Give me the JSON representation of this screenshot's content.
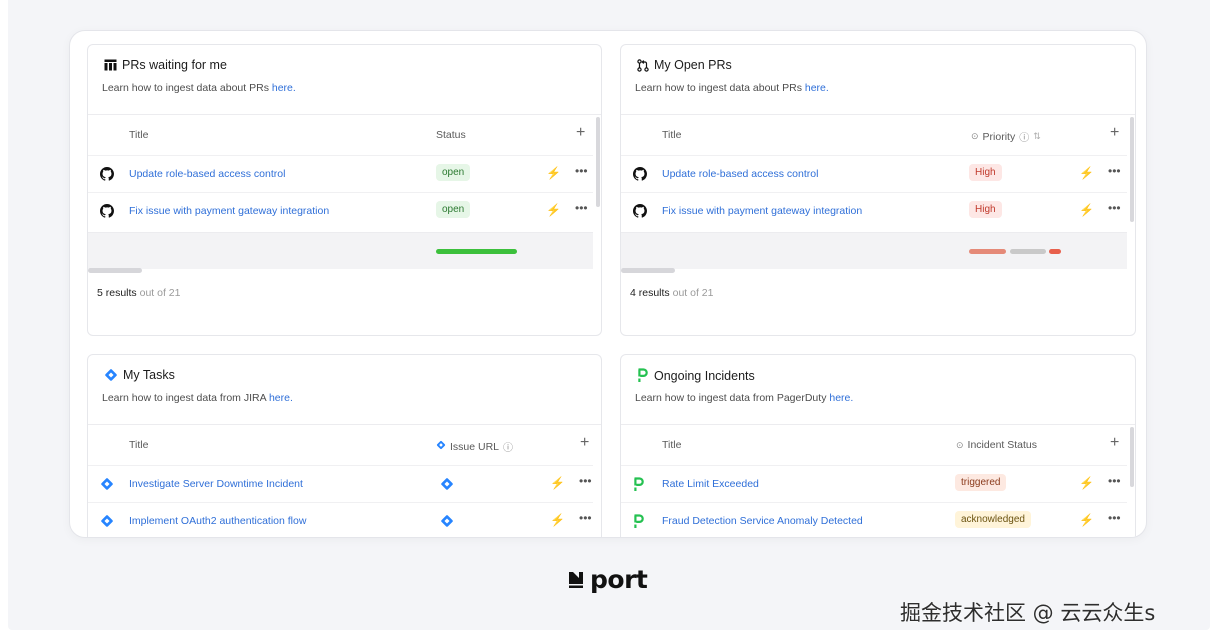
{
  "widgets": [
    {
      "title": "PRs waiting for me",
      "subtitle_prefix": "Learn how to ingest data about PRs ",
      "subtitle_link": "here.",
      "columns": [
        "Title",
        "Status"
      ],
      "rows": [
        {
          "title": "Update role-based access control",
          "value": "open"
        },
        {
          "title": "Fix issue with payment gateway integration",
          "value": "open"
        }
      ],
      "results_count": "5 results",
      "results_total": "out of 21"
    },
    {
      "title": "My Open PRs",
      "subtitle_prefix": "Learn how to ingest data about PRs ",
      "subtitle_link": "here.",
      "columns": [
        "Title",
        "Priority"
      ],
      "rows": [
        {
          "title": "Update role-based access control",
          "value": "High"
        },
        {
          "title": "Fix issue with payment gateway integration",
          "value": "High"
        }
      ],
      "results_count": "4 results",
      "results_total": "out of 21"
    },
    {
      "title": "My Tasks",
      "subtitle_prefix": "Learn how to ingest data from JIRA ",
      "subtitle_link": "here.",
      "columns": [
        "Title",
        "Issue URL"
      ],
      "rows": [
        {
          "title": "Investigate Server Downtime Incident"
        },
        {
          "title": "Implement OAuth2 authentication flow"
        }
      ]
    },
    {
      "title": "Ongoing Incidents",
      "subtitle_prefix": "Learn how to ingest data from PagerDuty ",
      "subtitle_link": "here.",
      "columns": [
        "Title",
        "Incident Status"
      ],
      "rows": [
        {
          "title": "Rate Limit Exceeded",
          "value": "triggered"
        },
        {
          "title": "Fraud Detection Service Anomaly Detected",
          "value": "acknowledged"
        }
      ]
    }
  ],
  "icons": {
    "w1_title": "table-icon",
    "w2_title": "git-pull-request-icon",
    "w3_title": "jira-icon",
    "w4_title": "pagerduty-icon",
    "github_row": "github-icon",
    "jira_row": "jira-icon",
    "pagerduty_row": "pagerduty-icon",
    "action": "lightning-icon",
    "menu": "more-horizontal-icon"
  },
  "colors": {
    "link": "#2f6fd8",
    "status_bar_open": "#3cc03c",
    "priority_bar_1": "#e58a78",
    "priority_bar_2": "#c9c9c9",
    "priority_bar_3": "#e8604c",
    "jira": "#2684ff",
    "pagerduty": "#25c151"
  },
  "brand": {
    "logo_text": "port"
  },
  "watermark": "掘金技术社区 @ 云云众生s"
}
